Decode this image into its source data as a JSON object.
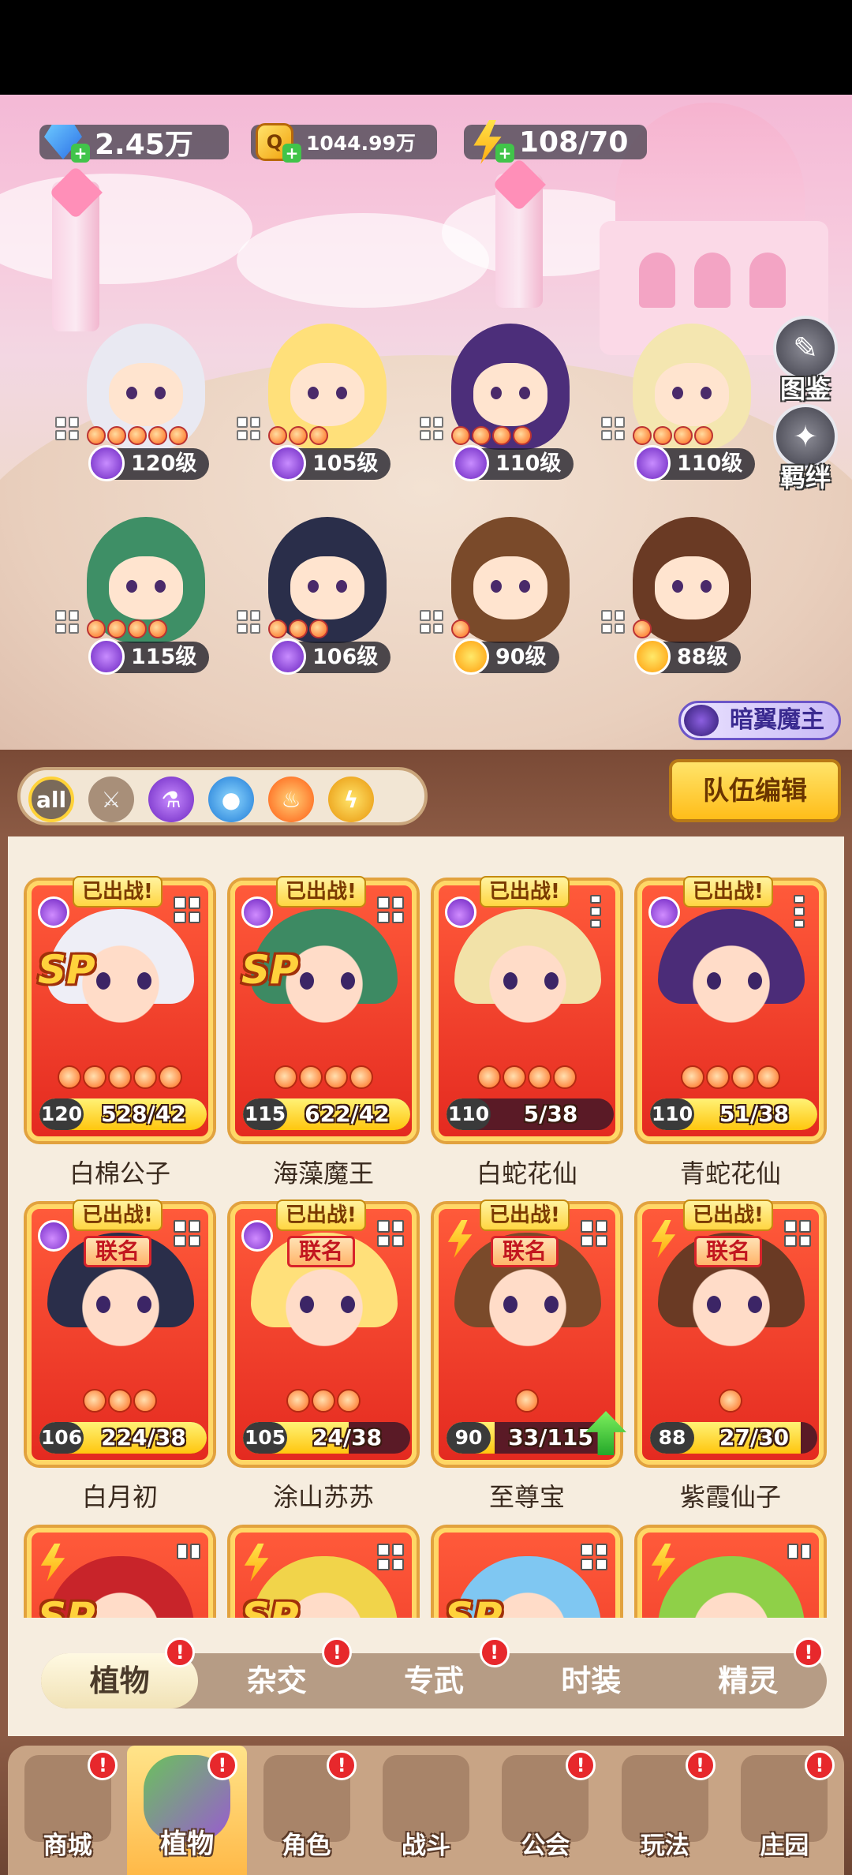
{
  "currency": {
    "gems": "2.45万",
    "coins": "1044.99万",
    "energy": "108/70",
    "coin_symbol": "Q",
    "plus": "+"
  },
  "side_buttons": [
    {
      "label": "图鉴",
      "icon": "book-scroll-icon"
    },
    {
      "label": "羁绊",
      "icon": "bond-star-icon"
    }
  ],
  "team_slots": [
    {
      "level": "120级",
      "element": "potion",
      "hair": "#e9e9f2",
      "stars": 5
    },
    {
      "level": "105级",
      "element": "potion",
      "hair": "#ffe07a",
      "stars": 3
    },
    {
      "level": "110级",
      "element": "potion",
      "hair": "#4c2e7a",
      "stars": 4
    },
    {
      "level": "110级",
      "element": "potion",
      "hair": "#f4e6b0",
      "stars": 4
    },
    {
      "level": "115级",
      "element": "potion",
      "hair": "#3e8f66",
      "stars": 4
    },
    {
      "level": "106级",
      "element": "potion",
      "hair": "#2a2e4a",
      "stars": 3
    },
    {
      "level": "90级",
      "element": "bolt",
      "hair": "#7a4a2a",
      "stars": 1
    },
    {
      "level": "88级",
      "element": "bolt",
      "hair": "#6a3a24",
      "stars": 1
    }
  ],
  "boss_tag": "暗翼魔主",
  "filters": [
    {
      "label": "all",
      "icon": "all-filter-icon"
    },
    {
      "label": "",
      "icon": "sword-icon"
    },
    {
      "label": "",
      "icon": "potion-icon"
    },
    {
      "label": "",
      "icon": "water-drop-icon"
    },
    {
      "label": "",
      "icon": "fire-icon"
    },
    {
      "label": "",
      "icon": "lightning-icon"
    }
  ],
  "team_edit_label": "队伍编辑",
  "cards": [
    {
      "name": "白棉公子",
      "level": "120",
      "progress": "528/42",
      "fill": 1.0,
      "deployed": "已出战!",
      "link": "",
      "sp": "SP",
      "element": "potion",
      "stars": 5,
      "hair": "#eeeef6",
      "menu": "grid"
    },
    {
      "name": "海藻魔王",
      "level": "115",
      "progress": "622/42",
      "fill": 1.0,
      "deployed": "已出战!",
      "link": "",
      "sp": "SP",
      "element": "potion",
      "stars": 4,
      "hair": "#3d8a63",
      "menu": "grid"
    },
    {
      "name": "白蛇花仙",
      "level": "110",
      "progress": "5/38",
      "fill": 0.13,
      "deployed": "已出战!",
      "link": "",
      "sp": "",
      "element": "potion",
      "stars": 4,
      "hair": "#f2e2a8",
      "menu": "vertical"
    },
    {
      "name": "青蛇花仙",
      "level": "110",
      "progress": "51/38",
      "fill": 1.0,
      "deployed": "已出战!",
      "link": "",
      "sp": "",
      "element": "potion",
      "stars": 4,
      "hair": "#4b2c78",
      "menu": "vertical"
    },
    {
      "name": "白月初",
      "level": "106",
      "progress": "224/38",
      "fill": 1.0,
      "deployed": "已出战!",
      "link": "联名",
      "sp": "",
      "element": "potion",
      "stars": 3,
      "hair": "#2a2e4a",
      "menu": "grid"
    },
    {
      "name": "涂山苏苏",
      "level": "105",
      "progress": "24/38",
      "fill": 0.63,
      "deployed": "已出战!",
      "link": "联名",
      "sp": "",
      "element": "potion",
      "stars": 3,
      "hair": "#ffe07a",
      "menu": "grid"
    },
    {
      "name": "至尊宝",
      "level": "90",
      "progress": "33/115",
      "fill": 0.29,
      "deployed": "已出战!",
      "link": "联名",
      "sp": "",
      "element": "bolt",
      "stars": 1,
      "hair": "#7a4a2a",
      "menu": "grid",
      "upgrade": true
    },
    {
      "name": "紫霞仙子",
      "level": "88",
      "progress": "27/30",
      "fill": 0.9,
      "deployed": "已出战!",
      "link": "联名",
      "sp": "",
      "element": "bolt",
      "stars": 1,
      "hair": "#6a3a24",
      "menu": "grid"
    },
    {
      "name": "",
      "level": "",
      "progress": "",
      "fill": 0,
      "deployed": "",
      "link": "",
      "sp": "SP",
      "element": "bolt",
      "stars": 0,
      "hair": "#c8242a",
      "menu": "small"
    },
    {
      "name": "",
      "level": "",
      "progress": "",
      "fill": 0,
      "deployed": "",
      "link": "",
      "sp": "SP",
      "element": "bolt",
      "stars": 0,
      "hair": "#f1d44a",
      "menu": "grid"
    },
    {
      "name": "",
      "level": "",
      "progress": "",
      "fill": 0,
      "deployed": "",
      "link": "",
      "sp": "SP",
      "element": "",
      "stars": 0,
      "hair": "#7fc7f2",
      "menu": "grid"
    },
    {
      "name": "",
      "level": "",
      "progress": "",
      "fill": 0,
      "deployed": "",
      "link": "",
      "sp": "",
      "element": "bolt",
      "stars": 0,
      "hair": "#8fd048",
      "menu": "small"
    }
  ],
  "sub_tabs": [
    {
      "label": "植物",
      "active": true,
      "alert": "!"
    },
    {
      "label": "杂交",
      "active": false,
      "alert": "!"
    },
    {
      "label": "专武",
      "active": false,
      "alert": "!"
    },
    {
      "label": "时装",
      "active": false,
      "alert": ""
    },
    {
      "label": "精灵",
      "active": false,
      "alert": "!"
    }
  ],
  "nav": [
    {
      "label": "商城",
      "icon": "shop-icon",
      "active": false,
      "alert": "!"
    },
    {
      "label": "植物",
      "icon": "plant-icon",
      "active": true,
      "alert": "!"
    },
    {
      "label": "角色",
      "icon": "character-icon",
      "active": false,
      "alert": "!"
    },
    {
      "label": "战斗",
      "icon": "battle-icon",
      "active": false,
      "alert": ""
    },
    {
      "label": "公会",
      "icon": "guild-icon",
      "active": false,
      "alert": "!"
    },
    {
      "label": "玩法",
      "icon": "gameplay-icon",
      "active": false,
      "alert": "!"
    },
    {
      "label": "庄园",
      "icon": "manor-icon",
      "active": false,
      "alert": "!"
    }
  ],
  "colors": {
    "accent_yellow": "#ffc60e",
    "card_red": "#e42a20",
    "alert_red": "#e7282c",
    "wood_brown": "#8b5a44"
  }
}
